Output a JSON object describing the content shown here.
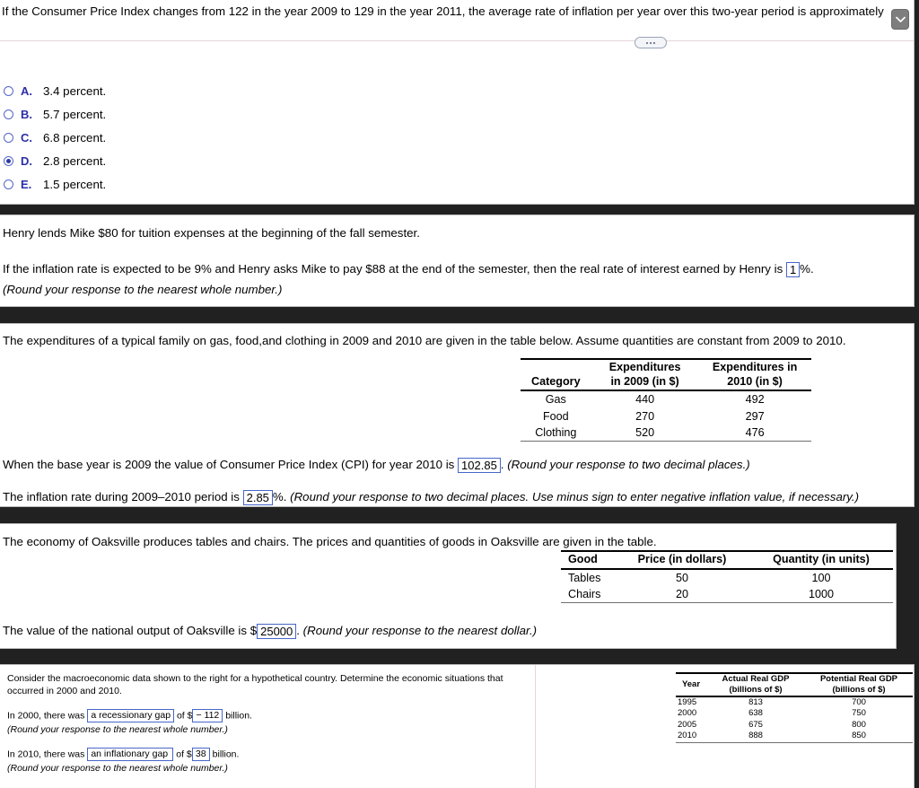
{
  "section1": {
    "question": "If the Consumer Price Index changes from 122 in the year 2009 to 129 in the year 2011, the average rate of inflation per year over this two-year period is approximately",
    "scroll_icon": "chevron-down-icon",
    "more_icon": "ellipsis-icon",
    "choices": [
      {
        "letter": "A.",
        "text": "3.4 percent.",
        "selected": false
      },
      {
        "letter": "B.",
        "text": "5.7 percent.",
        "selected": false
      },
      {
        "letter": "C.",
        "text": "6.8 percent.",
        "selected": false
      },
      {
        "letter": "D.",
        "text": "2.8 percent.",
        "selected": true
      },
      {
        "letter": "E.",
        "text": "1.5 percent.",
        "selected": false
      }
    ]
  },
  "section2": {
    "line1": "Henry lends Mike $80 for tuition expenses at the beginning of the fall semester.",
    "line2_pre": "If the inflation rate is expected to be 9% and Henry asks Mike to pay $88 at the end of the semester, then the real rate of interest earned by Henry is",
    "answer": "1",
    "line2_post": "%.",
    "note": "(Round your response to the nearest whole number.)"
  },
  "section3": {
    "intro": "The expenditures of a typical family on gas, food,and clothing in 2009 and 2010 are given in the table below. Assume quantities are constant from 2009 to 2010.",
    "table": {
      "headers": [
        "Category",
        "Expenditures in 2009 (in $)",
        "Expenditures in 2010 (in $)"
      ],
      "header_lines": [
        [
          "Category",
          ""
        ],
        [
          "Expenditures",
          "in 2009 (in $)"
        ],
        [
          "Expenditures in",
          "2010 (in $)"
        ]
      ],
      "rows": [
        [
          "Gas",
          "440",
          "492"
        ],
        [
          "Food",
          "270",
          "297"
        ],
        [
          "Clothing",
          "520",
          "476"
        ]
      ]
    },
    "cpi_pre": "When the base year is 2009 the value of Consumer Price Index (CPI) for year 2010 is",
    "cpi_answer": "102.85",
    "cpi_post": ".",
    "cpi_note": "(Round your response to two decimal places.)",
    "infl_pre": "The inflation rate during 2009–2010 period is",
    "infl_answer": "2.85",
    "infl_post": "%.",
    "infl_note": "(Round your response to two decimal places. Use minus sign to enter negative inflation value, if necessary.)"
  },
  "section4": {
    "intro": "The economy of Oaksville produces tables and chairs. The prices and quantities of goods in Oaksville are given in the table.",
    "table": {
      "headers": [
        "Good",
        "Price (in dollars)",
        "Quantity (in units)"
      ],
      "rows": [
        [
          "Tables",
          "50",
          "100"
        ],
        [
          "Chairs",
          "20",
          "1000"
        ]
      ]
    },
    "output_pre": "The value of the national output of Oaksville is $",
    "output_answer": "25000",
    "output_post": ".",
    "output_note": "(Round your response to the nearest dollar.)"
  },
  "section5": {
    "intro": "Consider the macroeconomic data shown to the right for a hypothetical country. Determine the economic situations that occurred in 2000 and 2010.",
    "row1_pre": "In 2000, there was",
    "row1_gap": "a recessionary gap",
    "row1_mid": "of $",
    "row1_value": "− 112",
    "row1_post": "billion.",
    "row1_note": "(Round your response to the nearest whole number.)",
    "row2_pre": "In 2010, there was",
    "row2_gap": "an inflationary gap",
    "row2_mid": "of $",
    "row2_value": "38",
    "row2_post": "billion.",
    "row2_note": "(Round your response to the nearest whole number.)",
    "table": {
      "header_lines": [
        [
          "Year",
          ""
        ],
        [
          "Actual Real GDP",
          "(billions of $)"
        ],
        [
          "Potential Real GDP",
          "(billions of $)"
        ]
      ],
      "rows": [
        [
          "1995",
          "813",
          "700"
        ],
        [
          "2000",
          "638",
          "750"
        ],
        [
          "2005",
          "675",
          "800"
        ],
        [
          "2010",
          "888",
          "850"
        ]
      ]
    }
  },
  "colors": {
    "accent_blue": "#2b2fa8",
    "input_border": "#4766c9",
    "background": "#212121",
    "divider": "#e6d5d8"
  }
}
